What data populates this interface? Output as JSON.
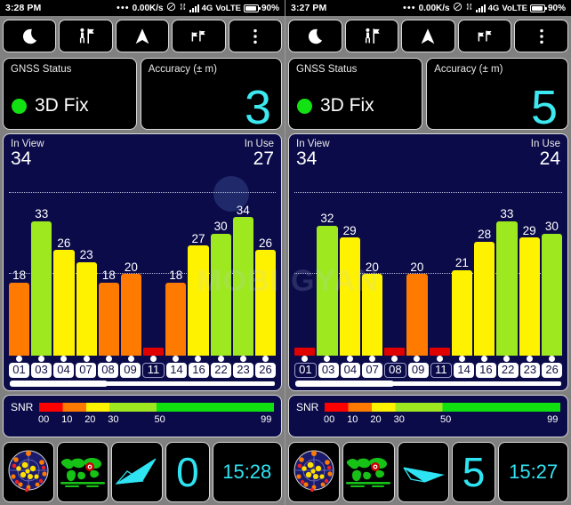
{
  "panels": [
    {
      "id": "left",
      "statusbar": {
        "time": "3:28 PM",
        "dots": "•••",
        "network_speed": "0.00K/s",
        "dnd_icon": "circle-slash-icon",
        "data_icon": "data-transfer-icon",
        "signal_icon": "signal-bars-icon",
        "network_type": "4G",
        "volte": "VoLTE",
        "battery_icon": "battery-icon",
        "battery_pct": "90%"
      },
      "toolbar": [
        {
          "name": "night-mode-button",
          "icon": "moon-icon"
        },
        {
          "name": "person-flag-button",
          "icon": "person-with-flag-icon"
        },
        {
          "name": "navigation-button",
          "icon": "navigation-arrow-icon"
        },
        {
          "name": "flags-button",
          "icon": "two-flags-icon"
        },
        {
          "name": "overflow-menu-button",
          "icon": "three-dots-vertical-icon"
        }
      ],
      "gnss": {
        "title": "GNSS Status",
        "value": "3D Fix",
        "dot_color": "#12e212"
      },
      "accuracy": {
        "title": "Accuracy (± m)",
        "value": "3",
        "color": "#3de8f0"
      },
      "counts": {
        "in_view_label": "In View",
        "in_view": "34",
        "in_use_label": "In Use",
        "in_use": "27"
      },
      "chart_data": {
        "type": "bar",
        "title": "Satellite SNR",
        "xlabel": "",
        "ylabel": "SNR",
        "ylim": [
          0,
          45
        ],
        "grid": true,
        "gridlines": [
          20,
          40
        ],
        "categories": [
          "01",
          "03",
          "04",
          "07",
          "08",
          "09",
          "11",
          "14",
          "16",
          "22",
          "23",
          "26"
        ],
        "values": [
          18,
          33,
          26,
          23,
          18,
          20,
          2,
          18,
          27,
          30,
          34,
          26
        ],
        "labels": [
          "18",
          "33",
          "26",
          "23",
          "18",
          "20",
          "",
          "18",
          "27",
          "30",
          "34",
          "26"
        ],
        "colors": [
          "#ff7a00",
          "#9ee820",
          "#fff200",
          "#fff200",
          "#ff7a00",
          "#ff7a00",
          "#e00000",
          "#ff7a00",
          "#fff200",
          "#9ee820",
          "#9ee820",
          "#fff200"
        ],
        "in_use": [
          true,
          true,
          true,
          true,
          true,
          true,
          false,
          true,
          true,
          true,
          true,
          true
        ]
      },
      "scroll": {
        "thumb_pct": 37
      },
      "snr": {
        "label": "SNR",
        "ticks": [
          {
            "text": "00",
            "pos": 0
          },
          {
            "text": "10",
            "pos": 10
          },
          {
            "text": "20",
            "pos": 20
          },
          {
            "text": "30",
            "pos": 30
          },
          {
            "text": "50",
            "pos": 50
          },
          {
            "text": "99",
            "pos": 99
          }
        ]
      },
      "bottom": {
        "sky_icon": "sky-view-globe-icon",
        "map_icon": "world-map-icon",
        "compass_icon": "compass-needle-icon",
        "speed": "0",
        "time": "15:28"
      },
      "watermark": "MOBIGYAN"
    },
    {
      "id": "right",
      "statusbar": {
        "time": "3:27 PM",
        "dots": "•••",
        "network_speed": "0.00K/s",
        "dnd_icon": "circle-slash-icon",
        "data_icon": "data-transfer-icon",
        "signal_icon": "signal-bars-icon",
        "network_type": "4G",
        "volte": "VoLTE",
        "battery_icon": "battery-icon",
        "battery_pct": "90%"
      },
      "toolbar": [
        {
          "name": "night-mode-button",
          "icon": "moon-icon"
        },
        {
          "name": "person-flag-button",
          "icon": "person-with-flag-icon"
        },
        {
          "name": "navigation-button",
          "icon": "navigation-arrow-icon"
        },
        {
          "name": "flags-button",
          "icon": "two-flags-icon"
        },
        {
          "name": "overflow-menu-button",
          "icon": "three-dots-vertical-icon"
        }
      ],
      "gnss": {
        "title": "GNSS Status",
        "value": "3D Fix",
        "dot_color": "#12e212"
      },
      "accuracy": {
        "title": "Accuracy (± m)",
        "value": "5",
        "color": "#3de8f0"
      },
      "counts": {
        "in_view_label": "In View",
        "in_view": "34",
        "in_use_label": "In Use",
        "in_use": "24"
      },
      "chart_data": {
        "type": "bar",
        "title": "Satellite SNR",
        "xlabel": "",
        "ylabel": "SNR",
        "ylim": [
          0,
          45
        ],
        "grid": true,
        "gridlines": [
          20,
          40
        ],
        "categories": [
          "01",
          "03",
          "04",
          "07",
          "08",
          "09",
          "11",
          "14",
          "16",
          "22",
          "23",
          "26"
        ],
        "values": [
          2,
          32,
          29,
          20,
          2,
          20,
          2,
          21,
          28,
          33,
          29,
          30
        ],
        "labels": [
          "",
          "32",
          "29",
          "20",
          "",
          "20",
          "",
          "21",
          "28",
          "33",
          "29",
          "30"
        ],
        "colors": [
          "#e00000",
          "#9ee820",
          "#fff200",
          "#fff200",
          "#e00000",
          "#ff7a00",
          "#e00000",
          "#fff200",
          "#fff200",
          "#9ee820",
          "#fff200",
          "#9ee820"
        ],
        "in_use": [
          false,
          true,
          true,
          true,
          false,
          true,
          false,
          true,
          true,
          true,
          true,
          true
        ]
      },
      "scroll": {
        "thumb_pct": 37
      },
      "snr": {
        "label": "SNR",
        "ticks": [
          {
            "text": "00",
            "pos": 0
          },
          {
            "text": "10",
            "pos": 10
          },
          {
            "text": "20",
            "pos": 20
          },
          {
            "text": "30",
            "pos": 30
          },
          {
            "text": "50",
            "pos": 50
          },
          {
            "text": "99",
            "pos": 99
          }
        ]
      },
      "bottom": {
        "sky_icon": "sky-view-globe-icon",
        "map_icon": "world-map-icon",
        "compass_icon": "compass-needle-icon",
        "speed": "5",
        "time": "15:27"
      },
      "watermark": "MOBIGYAN"
    }
  ]
}
